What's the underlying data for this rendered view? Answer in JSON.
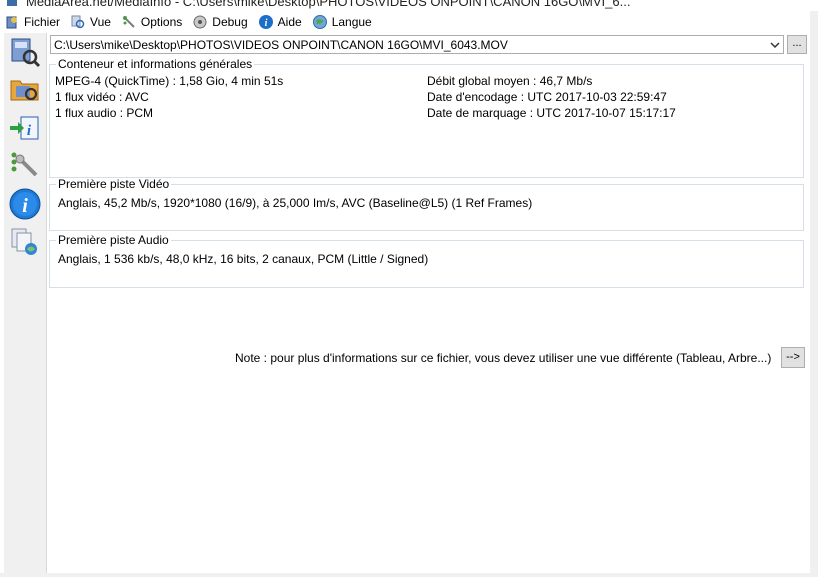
{
  "window": {
    "title": "MediaArea.net/MediaInfo - C:\\Users\\mike\\Desktop\\PHOTOS\\VIDEOS ONPOINT\\CANON 16GO\\MVI_6..."
  },
  "menu": [
    {
      "label": "Fichier",
      "icon": "fichier-icon"
    },
    {
      "label": "Vue",
      "icon": "vue-icon"
    },
    {
      "label": "Options",
      "icon": "options-icon"
    },
    {
      "label": "Debug",
      "icon": "debug-icon"
    },
    {
      "label": "Aide",
      "icon": "aide-icon"
    },
    {
      "label": "Langue",
      "icon": "langue-icon"
    }
  ],
  "sidebar": {
    "icons": [
      "open-file-icon",
      "open-folder-icon",
      "export-icon",
      "preferences-icon",
      "about-icon",
      "knowledge-base-icon"
    ]
  },
  "file": {
    "path": "C:\\Users\\mike\\Desktop\\PHOTOS\\VIDEOS ONPOINT\\CANON 16GO\\MVI_6043.MOV",
    "browse_label": "..."
  },
  "general": {
    "legend": "Conteneur et informations générales",
    "left": [
      "MPEG-4 (QuickTime) : 1,58 Gio, 4 min 51s",
      "1 flux vidéo : AVC",
      "1 flux audio : PCM"
    ],
    "right": [
      "Débit global moyen : 46,7 Mb/s",
      "Date d'encodage : UTC 2017-10-03 22:59:47",
      "Date de marquage : UTC 2017-10-07 15:17:17"
    ]
  },
  "video": {
    "legend": "Première piste Vidéo",
    "text": "Anglais, 45,2 Mb/s, 1920*1080 (16/9), à 25,000 Im/s, AVC (Baseline@L5) (1 Ref Frames)"
  },
  "audio": {
    "legend": "Première piste Audio",
    "text": "Anglais, 1 536 kb/s, 48,0 kHz, 16 bits, 2 canaux, PCM (Little / Signed)"
  },
  "note": {
    "text": "Note : pour plus d'informations sur ce fichier, vous devez utiliser une vue différente (Tableau, Arbre...)",
    "button_label": "-->"
  },
  "colors": {
    "accent": "#1e6fc8",
    "border": "#d5dfe5"
  }
}
